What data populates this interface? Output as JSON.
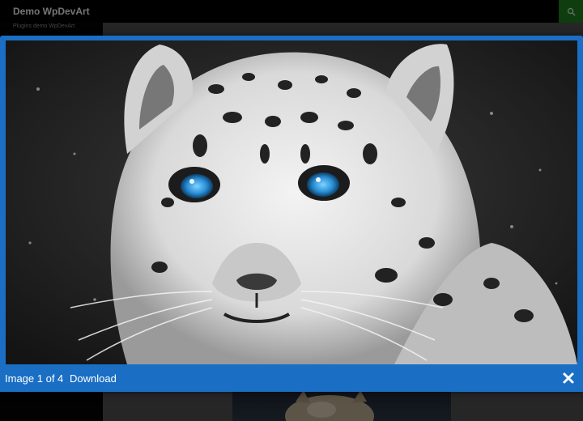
{
  "site": {
    "title": "Demo WpDevArt",
    "subtitle": "Plugins demo WpDevArt",
    "search_icon": "search-icon",
    "accent_color": "#1f7a1f"
  },
  "lightbox": {
    "image_alt": "Snow leopard close-up with blue eyes",
    "counter_text": "Image 1 of 4",
    "download_label": "Download",
    "close_icon": "close-icon",
    "frame_color": "#1a6fc4"
  }
}
